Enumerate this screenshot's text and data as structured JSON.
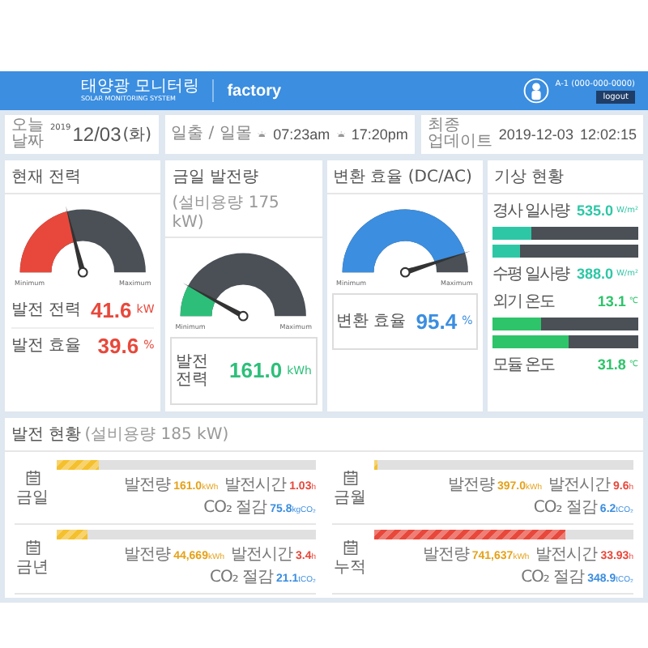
{
  "header": {
    "logo_title": "태양광 모니터링",
    "logo_subtitle": "SOLAR MONITORING SYSTEM",
    "site": "factory",
    "user": "A-1 (000-000-0000)",
    "logout": "logout"
  },
  "info": {
    "date_label": "오늘 날짜",
    "year": "2019",
    "date": "12/03",
    "weekday": "(화)",
    "sun_label": "일출 / 일몰",
    "sunrise": "07:23am",
    "sunset": "17:20pm",
    "update_label": "최종 업데이트",
    "update_date": "2019-12-03",
    "update_time": "12:02:15"
  },
  "gauges": [
    {
      "title": "현재 전력",
      "color": "#e8483b",
      "min": "Minimum",
      "max": "Maximum",
      "readings": [
        {
          "label": "발전 전력",
          "value": "41.6",
          "unit": "kW"
        },
        {
          "label": "발전 효율",
          "value": "39.6",
          "unit": "%"
        }
      ]
    },
    {
      "title": "금일 발전량",
      "subtitle": "(설비용량 175 kW)",
      "color": "#2dbf7a",
      "min": "Minimum",
      "max": "Maximum",
      "readings": [
        {
          "label": "발전 전력",
          "value": "161.0",
          "unit": "kWh"
        }
      ]
    },
    {
      "title": "변환 효율 (DC/AC)",
      "color": "#3b8ee0",
      "min": "Minimum",
      "max": "Maximum",
      "readings": [
        {
          "label": "변환 효율",
          "value": "95.4",
          "unit": "%"
        }
      ]
    }
  ],
  "weather": {
    "title": "기상 현황",
    "rows": [
      {
        "kind": "reading",
        "label": "경사 일사량",
        "value": "535.0",
        "unit": "W/m²",
        "color": "#2ec7a6"
      },
      {
        "kind": "bar",
        "level": 0.27,
        "color": "#2ec7a6"
      },
      {
        "kind": "bar",
        "level": 0.19,
        "color": "#2ec7a6"
      },
      {
        "kind": "reading",
        "label": "수평 일사량",
        "value": "388.0",
        "unit": "W/m²",
        "color": "#2ec7a6"
      },
      {
        "kind": "reading",
        "label": "외기 온도",
        "value": "13.1",
        "unit": "℃",
        "color": "#2dc46a"
      },
      {
        "kind": "bar",
        "level": 0.33,
        "color": "#2dc46a"
      },
      {
        "kind": "bar",
        "level": 0.52,
        "color": "#2dc46a"
      },
      {
        "kind": "reading",
        "label": "모듈 온도",
        "value": "31.8",
        "unit": "℃",
        "color": "#2dc46a"
      }
    ]
  },
  "production": {
    "title": "발전 현황",
    "subtitle": "(설비용량 185 kW)",
    "items": [
      {
        "period": "금일",
        "level": 0.16,
        "color": "#f5c02e",
        "stats": [
          {
            "label": "발전량",
            "value": "161.0",
            "unit": "kWh"
          },
          {
            "label": "발전시간",
            "value": "1.03",
            "unit": "h"
          },
          {
            "label": "CO₂ 절감",
            "value": "75.8",
            "unit": "kgCO₂"
          }
        ]
      },
      {
        "period": "금월",
        "level": 0.01,
        "color": "#f5c02e",
        "stats": [
          {
            "label": "발전량",
            "value": "397.0",
            "unit": "kWh"
          },
          {
            "label": "발전시간",
            "value": "9.6",
            "unit": "h"
          },
          {
            "label": "CO₂ 절감",
            "value": "6.2",
            "unit": "tCO₂"
          }
        ]
      },
      {
        "period": "금년",
        "level": 0.12,
        "color": "#f5c02e",
        "stats": [
          {
            "label": "발전량",
            "value": "44,669",
            "unit": "kWh"
          },
          {
            "label": "발전시간",
            "value": "3.4",
            "unit": "h"
          },
          {
            "label": "CO₂ 절감",
            "value": "21.1",
            "unit": "tCO₂"
          }
        ]
      },
      {
        "period": "누적",
        "level": 0.74,
        "color": "#e8483b",
        "stats": [
          {
            "label": "발전량",
            "value": "741,637",
            "unit": "kWh"
          },
          {
            "label": "발전시간",
            "value": "33.93",
            "unit": "h"
          },
          {
            "label": "CO₂ 절감",
            "value": "348.9",
            "unit": "tCO₂"
          }
        ]
      }
    ]
  }
}
